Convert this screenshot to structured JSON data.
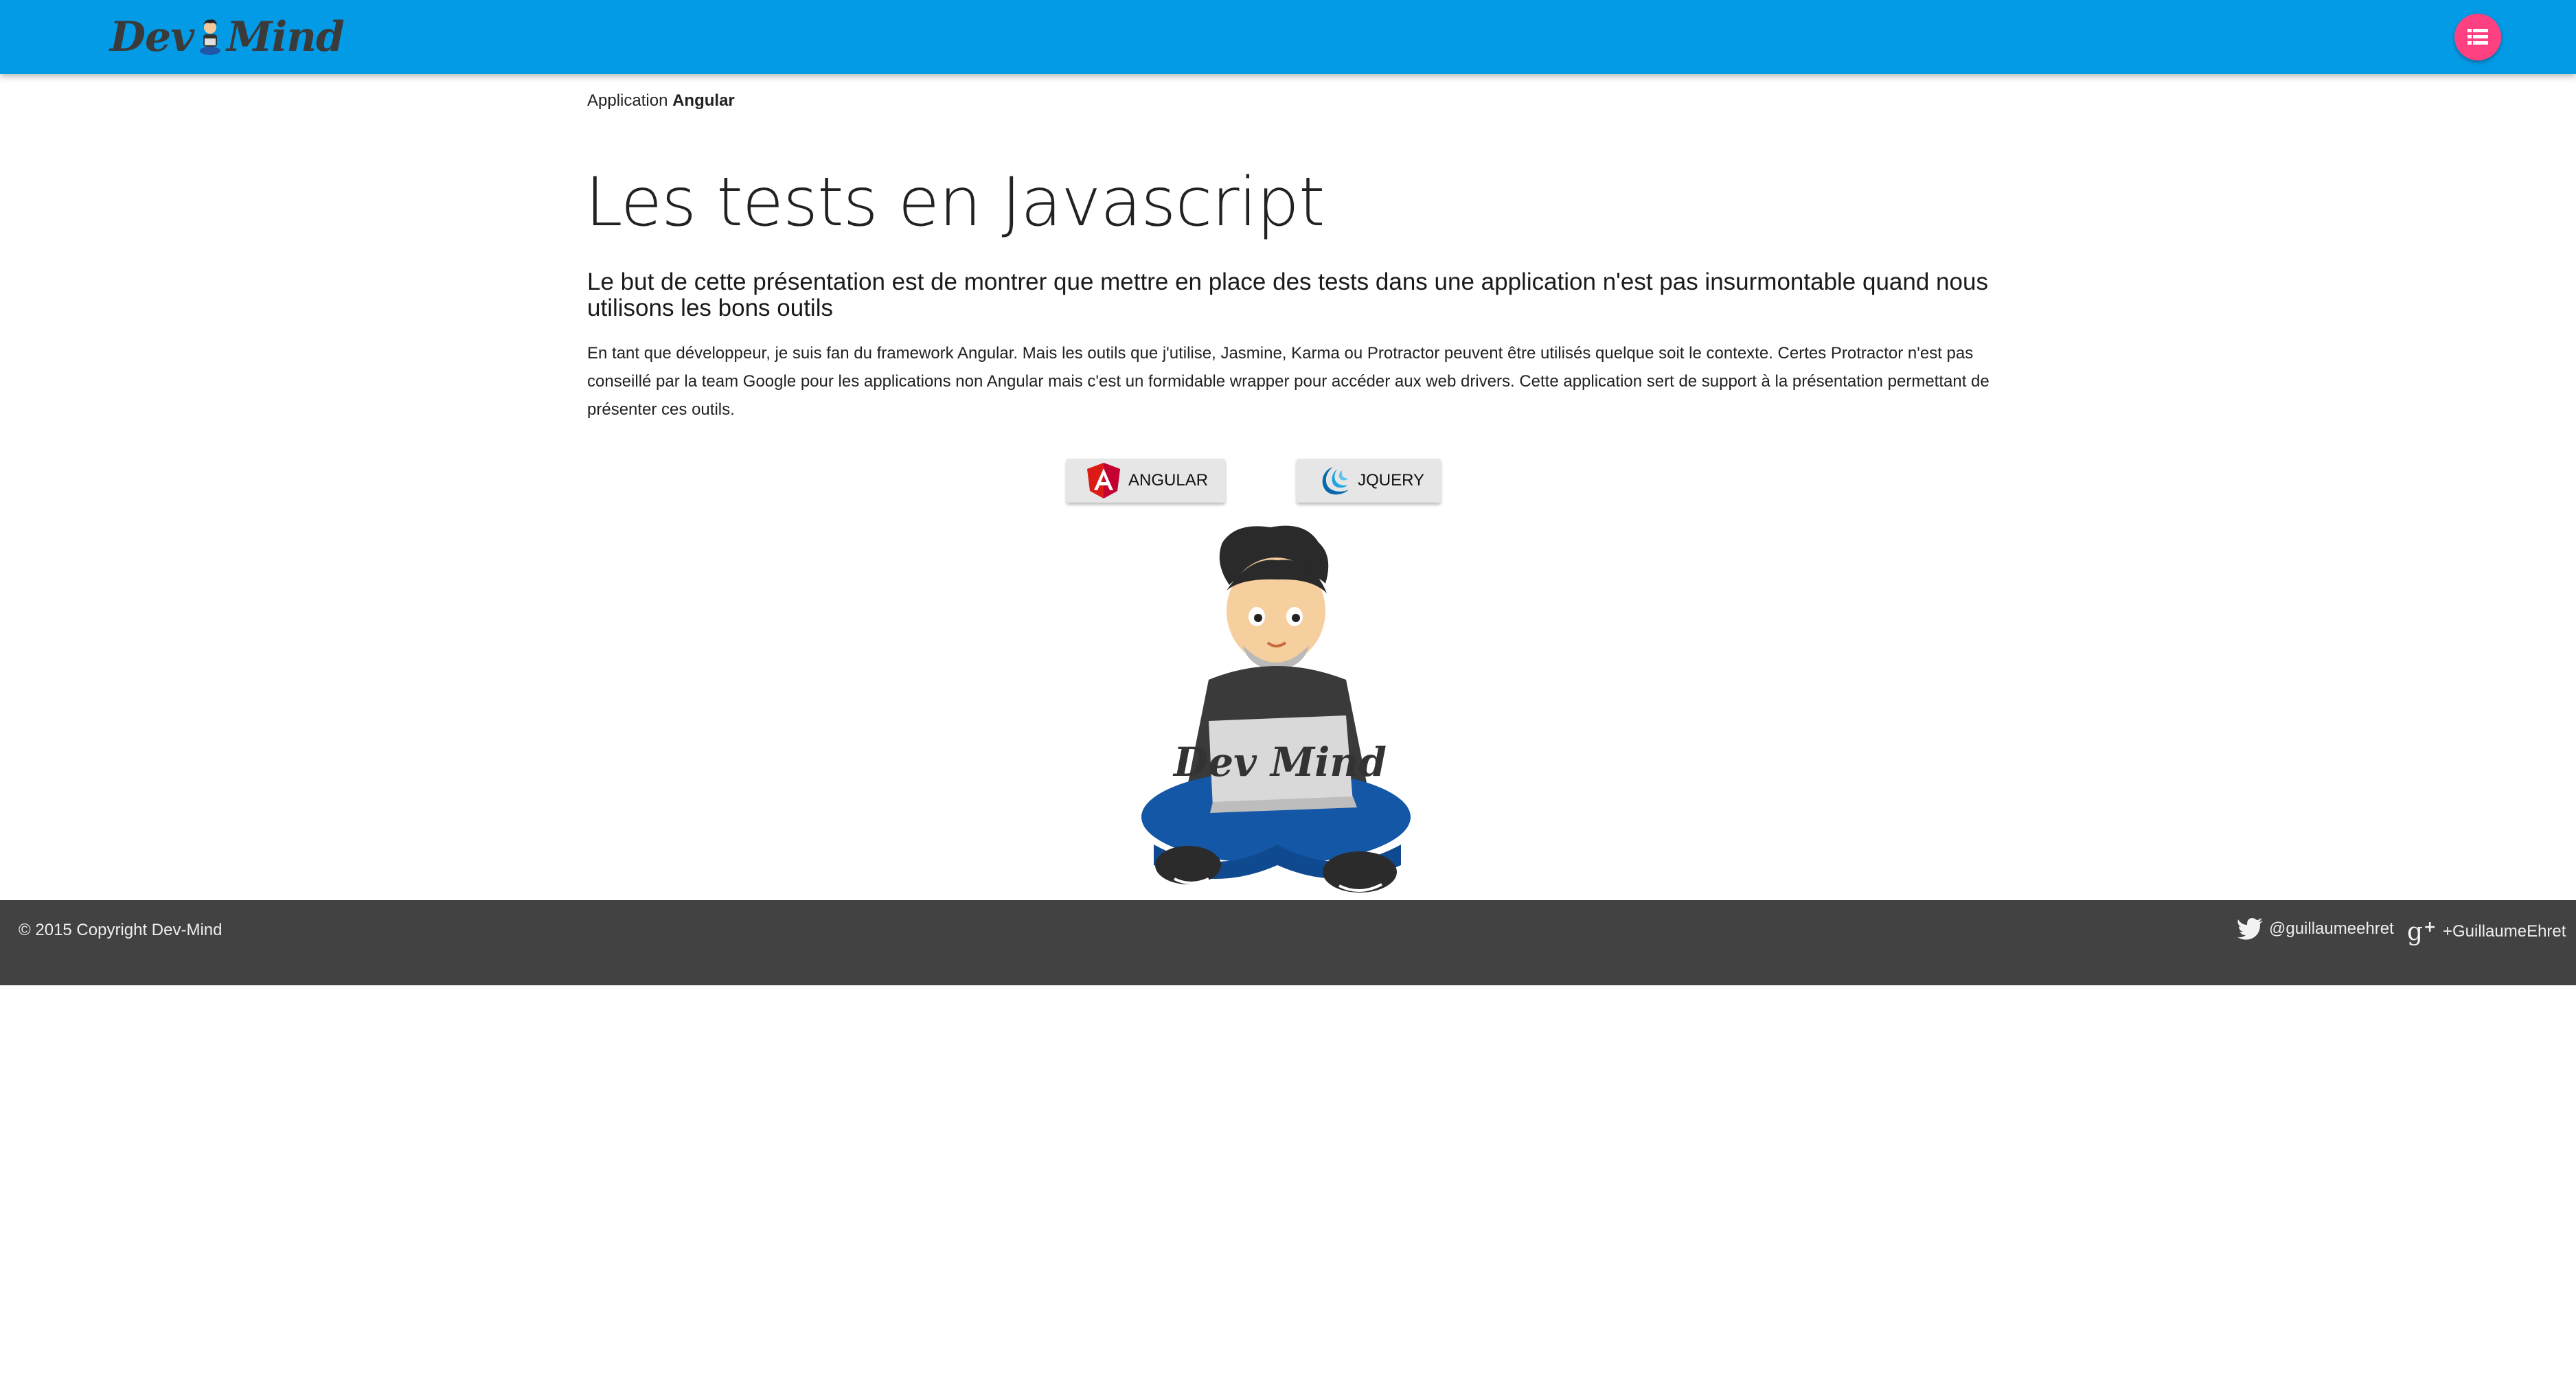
{
  "header": {
    "logo_left": "Dev",
    "logo_right": "Mind",
    "menu_icon": "list-icon",
    "accent_color": "#039be5",
    "menu_button_color": "#ff4081"
  },
  "breadcrumb": {
    "prefix": "Application",
    "current": "Angular"
  },
  "main": {
    "title": "Les tests en Javascript",
    "lead": "Le but de cette présentation est de montrer que mettre en place des tests dans une application n'est pas insurmontable quand nous utilisons les bons outils",
    "body": "En tant que développeur, je suis fan du framework Angular. Mais les outils que j'utilise, Jasmine, Karma ou Protractor peuvent être utilisés quelque soit le contexte. Certes Protractor n'est pas conseillé par la team Google pour les applications non Angular mais c'est un formidable wrapper pour accéder aux web drivers. Cette application sert de support à la présentation permettant de présenter ces outils.",
    "buttons": {
      "angular_label": "ANGULAR",
      "jquery_label": "JQUERY"
    },
    "mascot_laptop_text": "Dev Mind"
  },
  "footer": {
    "copyright": "© 2015 Copyright Dev-Mind",
    "twitter_handle": "@guillaumeehret",
    "gplus_handle": "+GuillaumeEhret",
    "background_color": "#424242"
  }
}
